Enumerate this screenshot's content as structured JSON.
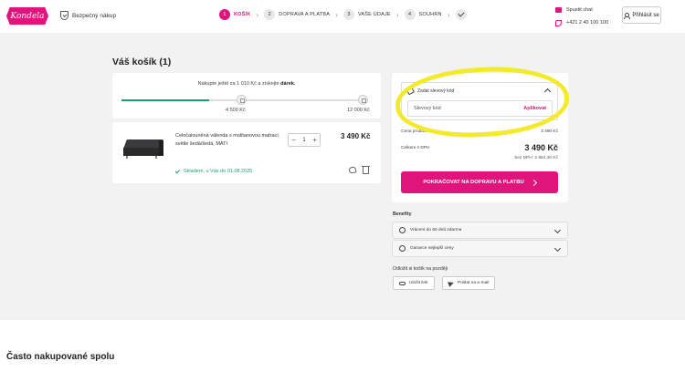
{
  "header": {
    "logo_text": "Kondela",
    "secure_label": "Bezpečný nákup",
    "steps": [
      {
        "num": "1",
        "label": "KOŠÍK"
      },
      {
        "num": "2",
        "label": "DOPRAVA A PLATBA"
      },
      {
        "num": "3",
        "label": "VAŠE ÚDAJE"
      },
      {
        "num": "4",
        "label": "SOUHRN"
      }
    ],
    "chat_label": "Spustit chat",
    "phone": "+421 2 40 100 100",
    "login_label": "Přihlásit se"
  },
  "cart": {
    "title": "Váš košík (1)",
    "progress": {
      "text_before": "Nakupte ještě za 1 010 Kč a získejte",
      "text_bold": "dárek.",
      "mark1": "4 500 Kč",
      "mark2": "12 000 Kč",
      "fill_fraction": 0.36
    },
    "item": {
      "name": "Celočalouněná válenda s molitanovou matrací, světle šedá/šedá, MATI",
      "quantity": "1",
      "minus": "−",
      "plus": "+",
      "price": "3 490 Kč",
      "stock": "Skladem, u Vás do 01.08.2025"
    }
  },
  "summary": {
    "coupon_toggle": "Zadat slevový kód",
    "coupon_placeholder": "Slevový kód",
    "coupon_apply": "Aplikovat",
    "products_label": "Cena produktů",
    "products_value": "3 490 Kč",
    "total_label": "Celkem s DPH",
    "total_value": "3 490 Kč",
    "vat_note": "bez DPH: 2 884,30 Kč",
    "cta": "POKRAČOVAT NA DOPRAVU A PLATBU"
  },
  "benefits": {
    "title": "Benefity",
    "items": [
      "Vrácení do 60 dnů zdarma",
      "Garance nejlepší ceny"
    ]
  },
  "save_cart": {
    "title": "Odložit si košík na později",
    "save_link": "Uložit link",
    "send_email": "Poslat na e-mail"
  },
  "bottom": {
    "title": "Často nakupované spolu"
  },
  "colors": {
    "accent": "#e0157b",
    "success": "#1e9e6e",
    "highlight": "#f2ea2a"
  }
}
